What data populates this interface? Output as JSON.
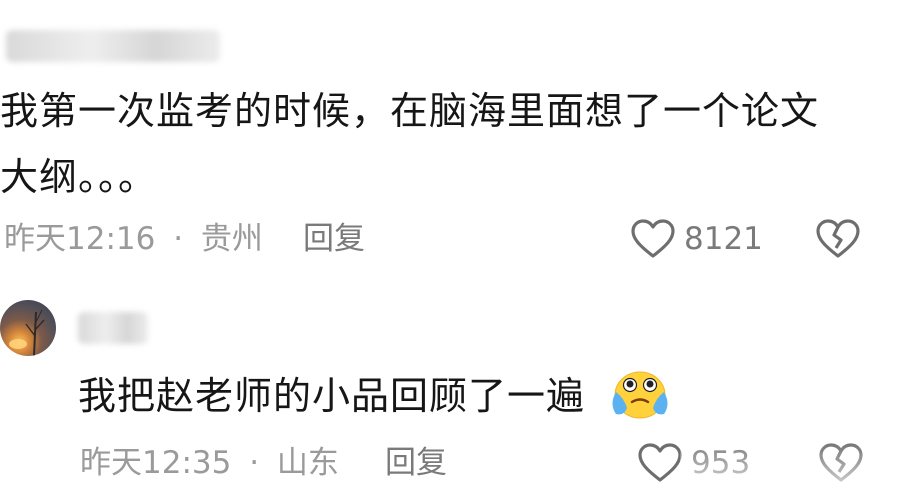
{
  "comments": [
    {
      "text_line1": "我第一次监考的时候，在脑海里面想了一个论文",
      "text_line2": "大纲。。。",
      "time": "昨天12:16",
      "separator": "·",
      "location": "贵州",
      "reply_label": "回复",
      "like_count": "8121",
      "icons": {
        "like": "heart-outline-icon",
        "dislike": "broken-heart-icon"
      }
    },
    {
      "text": "我把赵老师的小品回顾了一遍",
      "emoji": "crying-tears-of-joy-emoji",
      "time": "昨天12:35",
      "separator": "·",
      "location": "山东",
      "reply_label": "回复",
      "like_count": "953",
      "icons": {
        "like": "heart-outline-icon",
        "dislike": "broken-heart-icon"
      }
    }
  ]
}
